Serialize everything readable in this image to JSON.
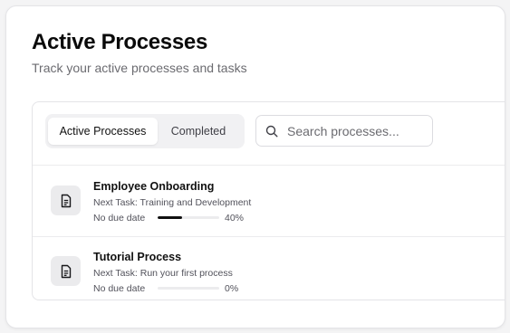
{
  "header": {
    "title": "Active Processes",
    "subtitle": "Track your active processes and tasks"
  },
  "tabs": [
    {
      "label": "Active Processes",
      "active": true
    },
    {
      "label": "Completed",
      "active": false
    }
  ],
  "search": {
    "placeholder": "Search processes...",
    "value": "",
    "icon": "search-icon"
  },
  "processes": [
    {
      "name": "Employee Onboarding",
      "next_task": "Next Task: Training and Development",
      "due": "No due date",
      "progress": 40,
      "progress_label": "40%",
      "icon": "document-icon"
    },
    {
      "name": "Tutorial Process",
      "next_task": "Next Task: Run your first process",
      "due": "No due date",
      "progress": 0,
      "progress_label": "0%",
      "icon": "document-icon"
    }
  ],
  "colors": {
    "progress_fill": "#111111",
    "progress_track": "#ececee",
    "icon_bg": "#ebebed"
  }
}
